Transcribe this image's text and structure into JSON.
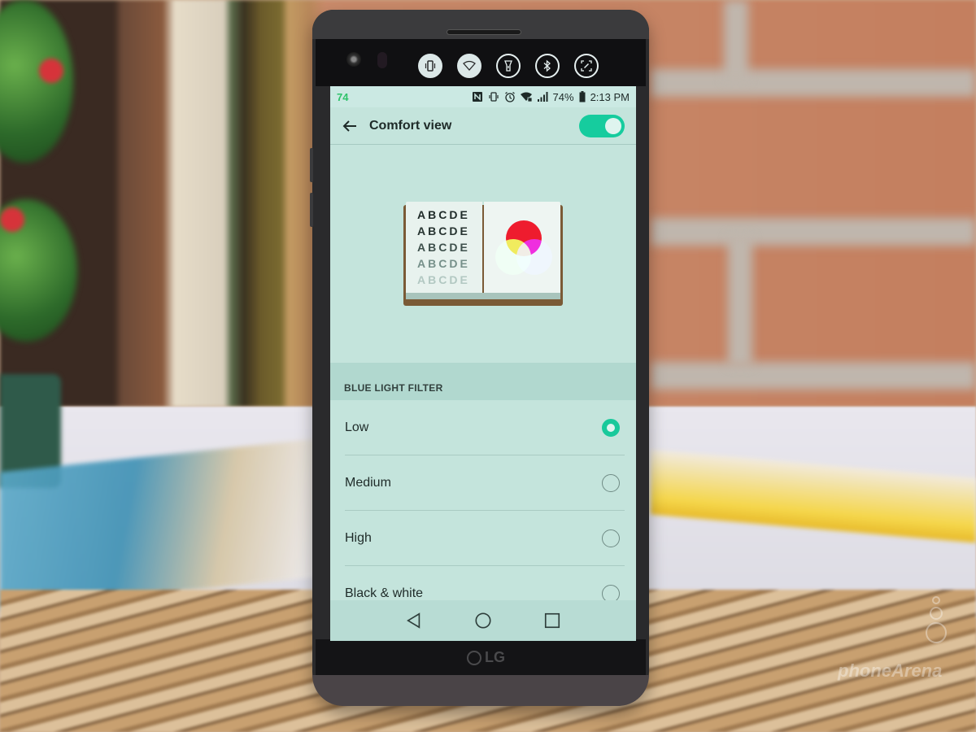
{
  "second_screen": {
    "buttons": [
      {
        "name": "vibrate-toggle",
        "icon": "vibrate-icon",
        "active": true
      },
      {
        "name": "wifi-toggle",
        "icon": "wifi-icon",
        "active": true
      },
      {
        "name": "flashlight-toggle",
        "icon": "flashlight-icon",
        "active": false
      },
      {
        "name": "bluetooth-toggle",
        "icon": "bluetooth-icon",
        "active": false
      },
      {
        "name": "screenshot-toggle",
        "icon": "capture-icon",
        "active": false
      }
    ]
  },
  "status_bar": {
    "left_indicator": "74",
    "icons": [
      "nfc-icon",
      "vibrate-icon",
      "alarm-icon",
      "wifi-locked-icon",
      "signal-icon"
    ],
    "battery": "74%",
    "time": "2:13 PM"
  },
  "app_bar": {
    "back_icon": "arrow-left-icon",
    "title": "Comfort view",
    "toggle_on": true
  },
  "illustration": {
    "rows": [
      "ABCDE",
      "ABCDE",
      "ABCDE",
      "ABCDE",
      "ABCDE"
    ],
    "colors": {
      "red": "#ee1c2e",
      "green": "#1fe83a",
      "blue": "#1414d8",
      "accent": "#16cc9e"
    }
  },
  "blue_light_filter": {
    "header": "BLUE LIGHT FILTER",
    "options": [
      {
        "label": "Low",
        "selected": true
      },
      {
        "label": "Medium",
        "selected": false
      },
      {
        "label": "High",
        "selected": false
      },
      {
        "label": "Black & white",
        "selected": false
      }
    ]
  },
  "nav_bar": {
    "back": "back-triangle-icon",
    "home": "home-circle-icon",
    "recents": "recents-square-icon"
  },
  "device": {
    "brand": "LG"
  },
  "watermark": "phoneArena"
}
